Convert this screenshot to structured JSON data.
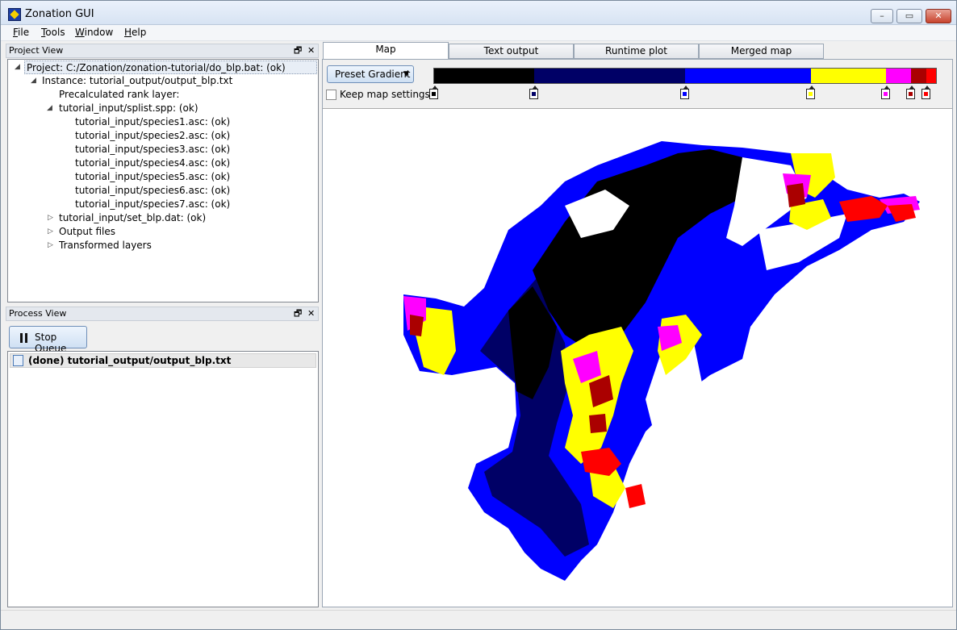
{
  "window": {
    "title": "Zonation GUI",
    "minimize_glyph": "–",
    "maximize_glyph": "▭",
    "close_glyph": "✕"
  },
  "menubar": {
    "items": [
      {
        "underline": "F",
        "rest": "ile"
      },
      {
        "underline": "T",
        "rest": "ools"
      },
      {
        "underline": "W",
        "rest": "indow"
      },
      {
        "underline": "H",
        "rest": "elp"
      }
    ]
  },
  "project_view": {
    "title": "Project View",
    "float_glyph": "🗗",
    "close_glyph": "✕",
    "root": "Project: C:/Zonation/zonation-tutorial/do_blp.bat: (ok)",
    "instance": "Instance: tutorial_output/output_blp.txt",
    "precalc": "Precalculated rank layer:",
    "splist": "tutorial_input/splist.spp: (ok)",
    "species": [
      "tutorial_input/species1.asc: (ok)",
      "tutorial_input/species2.asc: (ok)",
      "tutorial_input/species3.asc: (ok)",
      "tutorial_input/species4.asc: (ok)",
      "tutorial_input/species5.asc: (ok)",
      "tutorial_input/species6.asc: (ok)",
      "tutorial_input/species7.asc: (ok)"
    ],
    "set_file": "tutorial_input/set_blp.dat: (ok)",
    "output_files": "Output files",
    "transformed": "Transformed layers"
  },
  "process_view": {
    "title": "Process View",
    "float_glyph": "🗗",
    "close_glyph": "✕",
    "stop_queue_label": "Stop Queue",
    "queue_item": "(done) tutorial_output/output_blp.txt"
  },
  "tabs": [
    "Map",
    "Text output",
    "Runtime plot",
    "Merged map"
  ],
  "map_controls": {
    "preset_label": "Preset Gradient",
    "preset_arrow": "▼",
    "keep_settings_label": "Keep map settings",
    "keep_settings_checked": false
  },
  "gradient": {
    "stops_fraction": [
      0.0,
      0.2,
      0.5,
      0.75,
      0.9,
      0.95,
      0.98
    ],
    "colors": [
      "#000000",
      "#000066",
      "#0000ff",
      "#ffff00",
      "#ff00ff",
      "#aa0000",
      "#ff0000"
    ]
  }
}
